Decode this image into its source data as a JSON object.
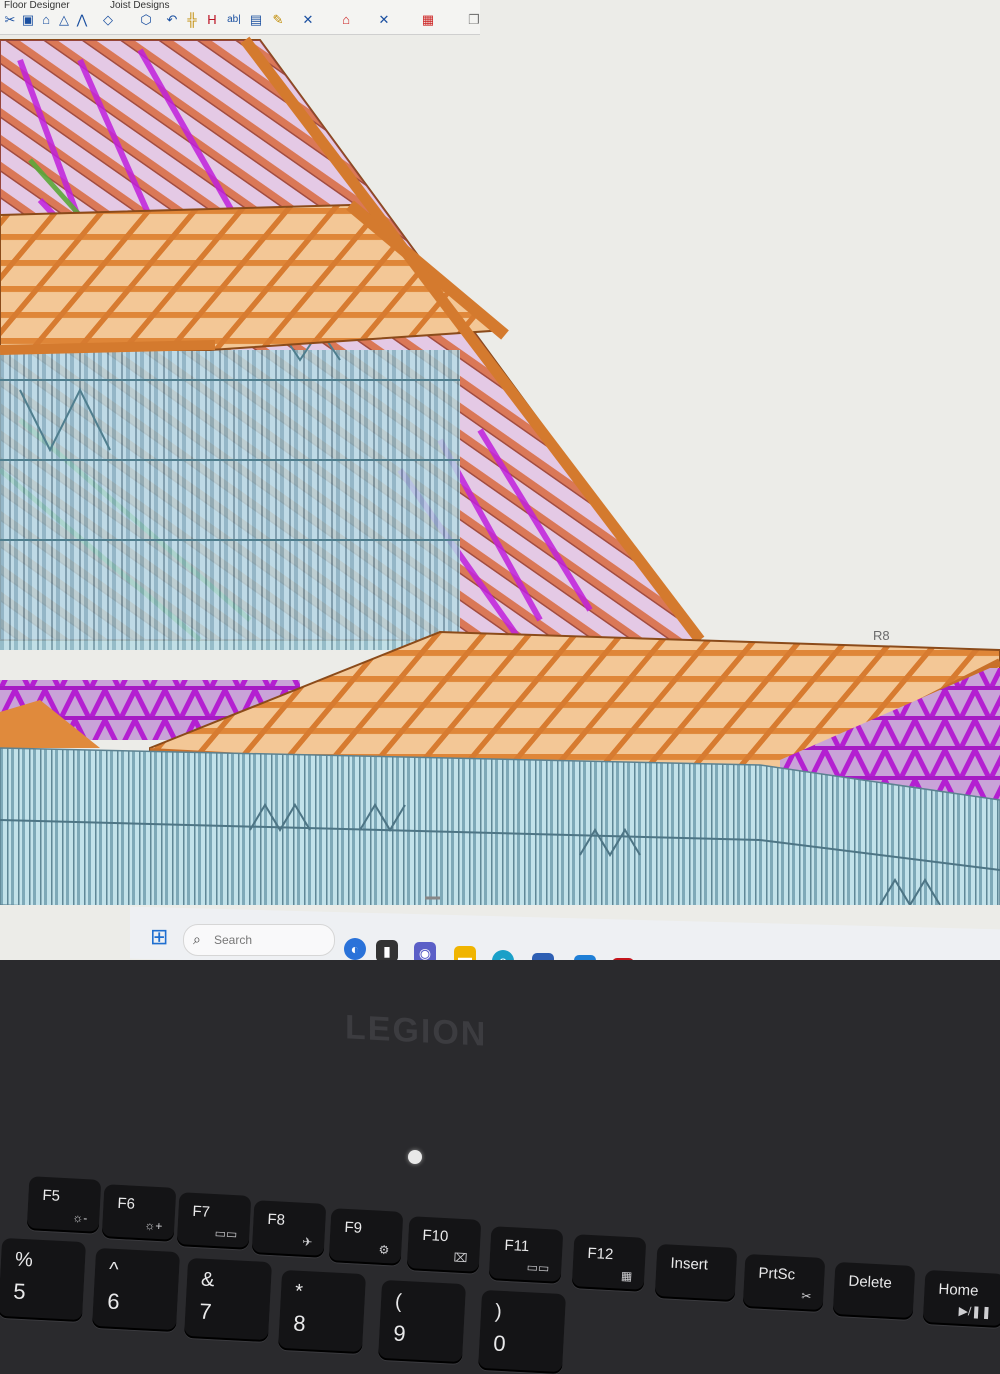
{
  "toolbar": {
    "tabs": [
      "Floor Designer",
      "Joist Designs"
    ],
    "icons": [
      "scissors-icon",
      "save-icon",
      "home-icon",
      "truss-icon",
      "cube-icon",
      "undo-icon",
      "post-icon",
      "beam-icon",
      "text-icon",
      "sheet-icon",
      "brush-icon",
      "wrench-icon",
      "roof-icon",
      "cross-icon",
      "gable-icon",
      "copy-icon"
    ]
  },
  "viewport": {
    "label_r8": "R8",
    "colors": {
      "truss_orange": "#e08a3c",
      "steel_blue": "#a7d3de",
      "magenta": "#c025d9",
      "green": "#5ea33a",
      "background": "#ecece8"
    }
  },
  "taskbar": {
    "search_placeholder": "Search",
    "apps": [
      "start-icon",
      "search-icon",
      "cortana-icon",
      "task-view-icon",
      "teams-icon",
      "file-explorer-icon",
      "edge-icon",
      "store-icon",
      "launcher-icon",
      "mcafee-icon",
      "xbox-icon",
      "cad-app-icon"
    ]
  },
  "laptop": {
    "brand": "LEGION",
    "keys_fn": [
      {
        "label": "F5",
        "sub": "☼-"
      },
      {
        "label": "F6",
        "sub": "☼+"
      },
      {
        "label": "F7",
        "sub": "▭▭"
      },
      {
        "label": "F8",
        "sub": "✈"
      },
      {
        "label": "F9",
        "sub": "⚙"
      },
      {
        "label": "F10",
        "sub": "⌧"
      },
      {
        "label": "F11",
        "sub": "▭▭"
      },
      {
        "label": "F12",
        "sub": "▦"
      },
      {
        "label": "Insert",
        "sub": ""
      },
      {
        "label": "PrtSc",
        "sub": "✂"
      },
      {
        "label": "Delete",
        "sub": ""
      },
      {
        "label": "Home",
        "sub": "▶/❚❚"
      }
    ],
    "keys_num": [
      {
        "top": "%",
        "bottom": "5"
      },
      {
        "top": "^",
        "bottom": "6"
      },
      {
        "top": "&",
        "bottom": "7"
      },
      {
        "top": "*",
        "bottom": "8"
      },
      {
        "top": "(",
        "bottom": "9"
      },
      {
        "top": ")",
        "bottom": "0"
      }
    ]
  }
}
